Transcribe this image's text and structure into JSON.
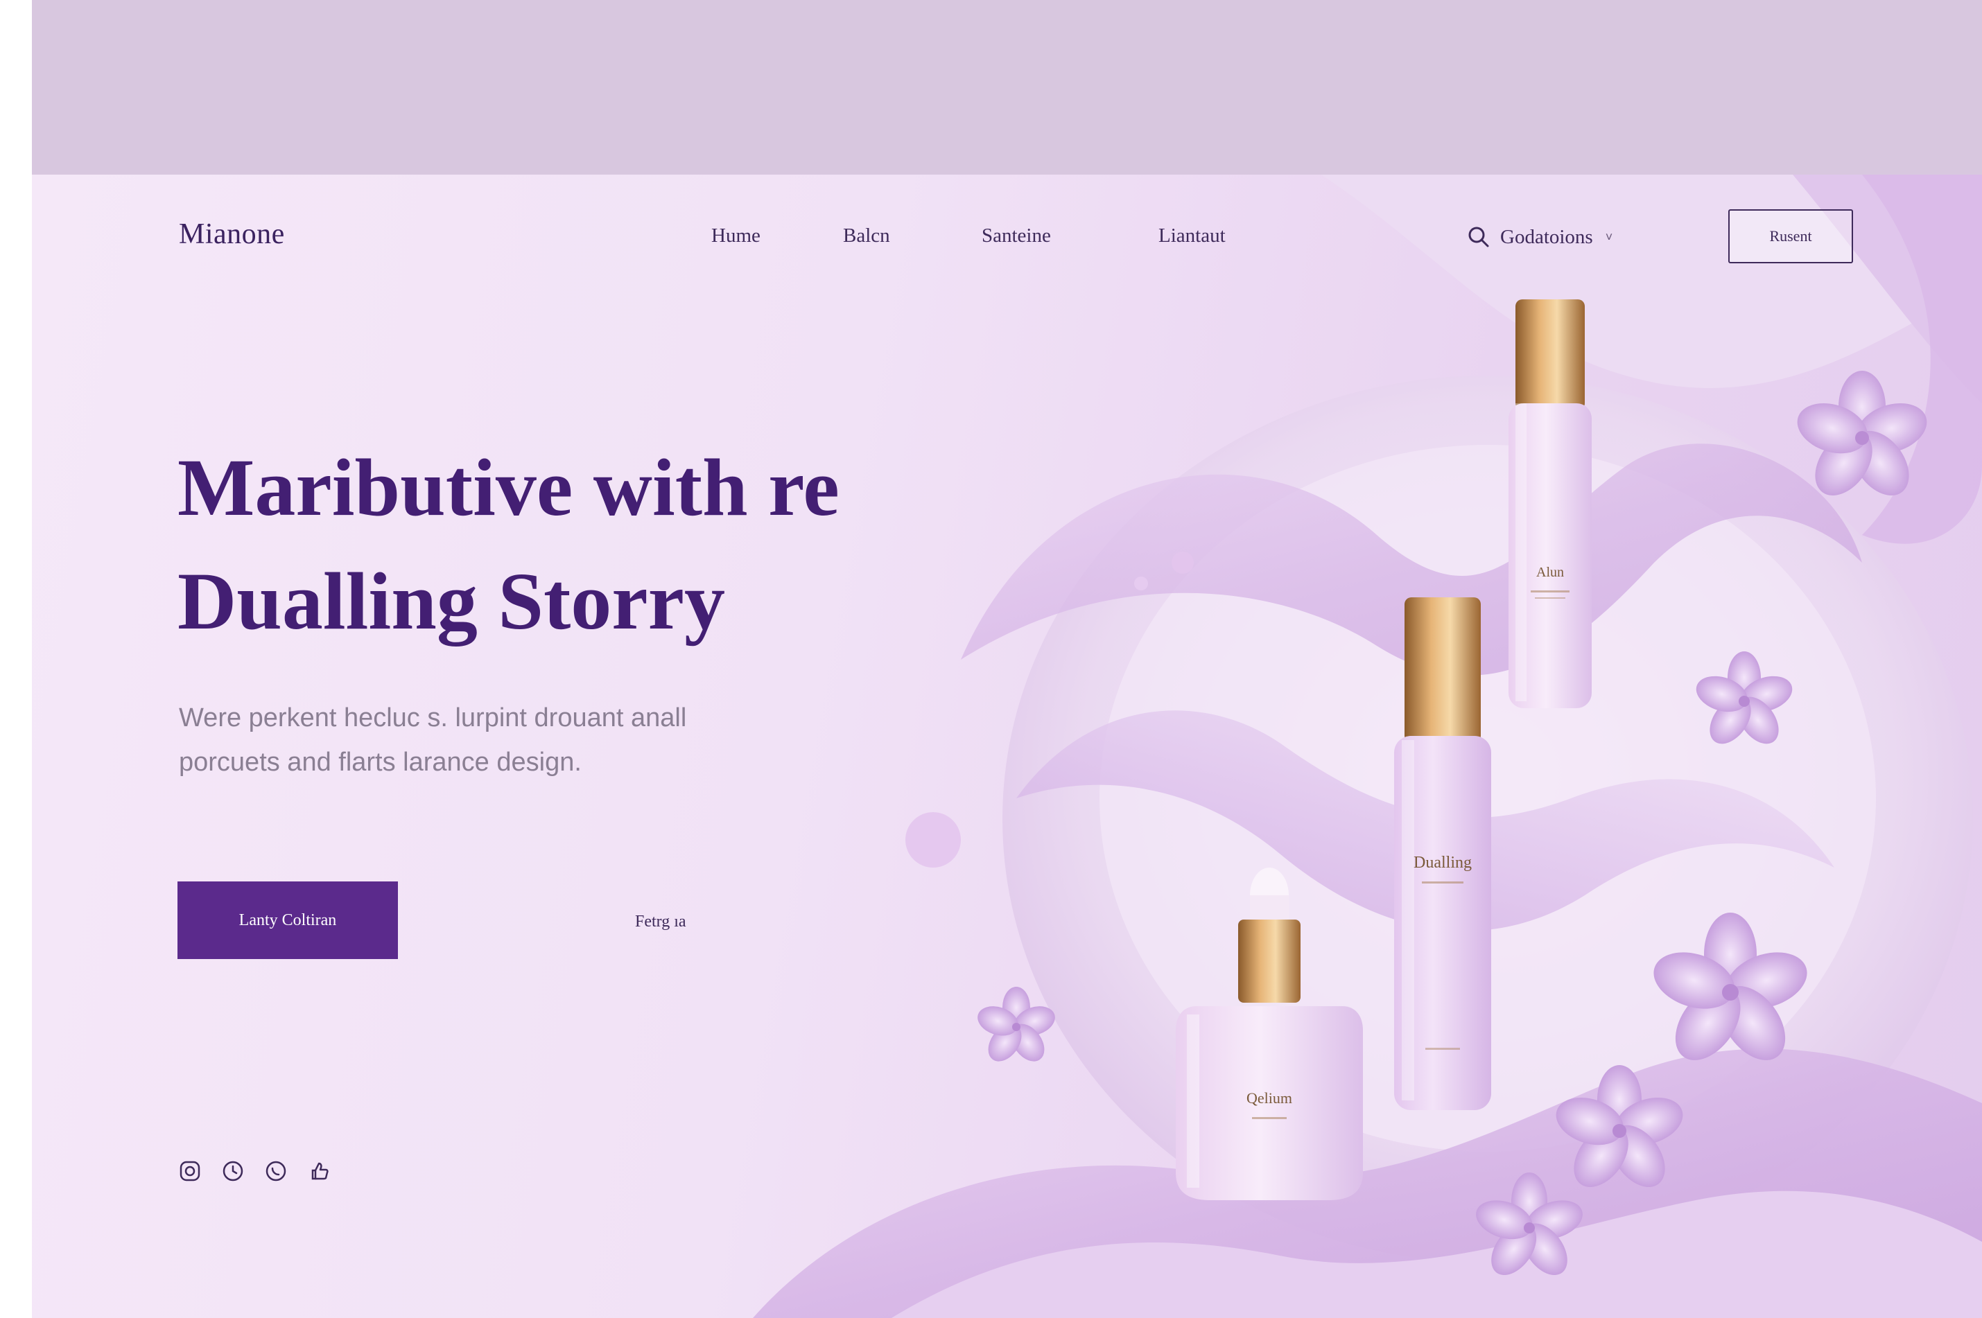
{
  "brand": {
    "logo": "Mianone"
  },
  "nav": {
    "items": [
      "Hume",
      "Balcn",
      "Santeine",
      "Liantaut"
    ],
    "search_label": "Godatoions",
    "button_label": "Rusent"
  },
  "hero": {
    "headline_line1": "Maributive with re",
    "headline_line2": "Dualling Storry",
    "subtext_line1": "Were perkent hecluc s. lurpint drouant anall",
    "subtext_line2": "porcuets and flarts larance design.",
    "cta_label": "Lanty Coltiran",
    "secondary_label": "Fetrg ıa"
  },
  "products": {
    "serum_label": "Dualling",
    "bottle_label": "Alun",
    "jar_label": "Qelium"
  },
  "socials": [
    "instagram-icon",
    "clock-icon",
    "whatsapp-icon",
    "like-icon"
  ],
  "colors": {
    "accent": "#5b2a8c",
    "headline": "#431f73",
    "top_band": "#d8c7df",
    "hero_bg": "#f1e2f6"
  }
}
